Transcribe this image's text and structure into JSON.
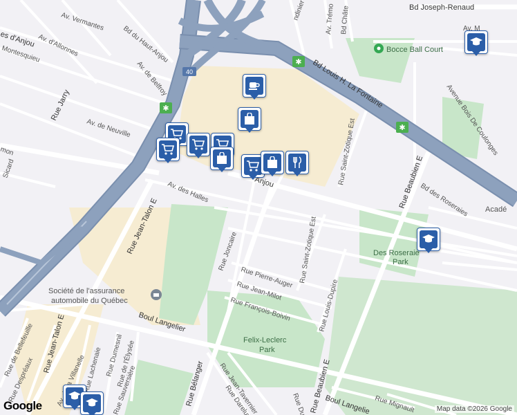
{
  "map": {
    "credit": "Map data ©2026 Google",
    "logo": "Google",
    "highway_shield": "40",
    "colors": {
      "background": "#f2f1f5",
      "park": "#c8e6c9",
      "highway": "#8da1bd",
      "highway_edge": "#7a8fae",
      "road": "#ffffff",
      "commercial": "#f6ecd2",
      "marker": "#2b5ea8"
    },
    "street_labels": [
      "Av. Vermantes",
      "Bd du Haut-Anjou",
      "Av. d'Allonnes",
      "Av. de Belfroy",
      "Montesquieu",
      "es d'Anjou",
      "Rue Jarry",
      "Av. de Neuville",
      "mon",
      "Sicard",
      "Av. des Halles",
      "Rue Jean-Talon E",
      "Rue Joncaire",
      "Rue Pierre-Auger",
      "Rue Jean-Milot",
      "Rue François-Boivin",
      "Boul Langelier",
      "Bd Louis H. La Fontaine",
      "Bd Joseph-Renaud",
      "Bd Châte",
      "Av. Trémo",
      "ndinier",
      "Av. M",
      "Avenue Bois De Coulonges",
      "Rue Saint-Zotique Est",
      "Rue Beaubien E",
      "Bd des Roseraies",
      "Rue Louis-Dupire",
      "Rue Jean-Talon E",
      "Rue de Bellefeuille",
      "Rue Despréaux",
      "Av. de la Villanelle",
      "Rue Dumesnil",
      "Rue de l'Élysée",
      "Rue Lachenaie",
      "Rue Sauversière",
      "Rue Bélanger",
      "Rue Jean-Tavernier",
      "Rue Dareluy",
      "Rue Dupire",
      "Boul Langelie",
      "Rue Mignault",
      "Rue Beaubien E",
      "Anjou",
      "Rue Saint-Zotique Est"
    ],
    "pois": [
      {
        "name": "Bocce Ball Court",
        "icon": "park-pin-icon"
      },
      {
        "name": "Société de l'assurance",
        "icon": "government-building-icon"
      },
      {
        "name": "automobile du Québec",
        "icon": ""
      },
      {
        "name": "Felix-Leclerc",
        "icon": ""
      },
      {
        "name": "Park",
        "icon": ""
      },
      {
        "name": "Des Roseraie",
        "icon": ""
      },
      {
        "name": "Park",
        "icon": ""
      },
      {
        "name": "Acadé",
        "icon": ""
      }
    ],
    "markers": [
      {
        "type": "cafe",
        "icon": "coffee-cup-icon"
      },
      {
        "type": "shopping",
        "icon": "shopping-bag-icon"
      },
      {
        "type": "grocery",
        "icon": "shopping-cart-icon"
      },
      {
        "type": "grocery",
        "icon": "shopping-cart-icon"
      },
      {
        "type": "grocery",
        "icon": "shopping-cart-icon"
      },
      {
        "type": "grocery",
        "icon": "shopping-cart-icon"
      },
      {
        "type": "shopping",
        "icon": "shopping-bag-icon"
      },
      {
        "type": "grocery",
        "icon": "shopping-cart-icon"
      },
      {
        "type": "shopping",
        "icon": "shopping-bag-icon"
      },
      {
        "type": "restaurant",
        "icon": "fork-knife-icon"
      },
      {
        "type": "school",
        "icon": "graduation-cap-icon"
      },
      {
        "type": "school",
        "icon": "graduation-cap-icon"
      },
      {
        "type": "school",
        "icon": "graduation-cap-icon"
      },
      {
        "type": "school",
        "icon": "graduation-cap-icon"
      }
    ]
  }
}
